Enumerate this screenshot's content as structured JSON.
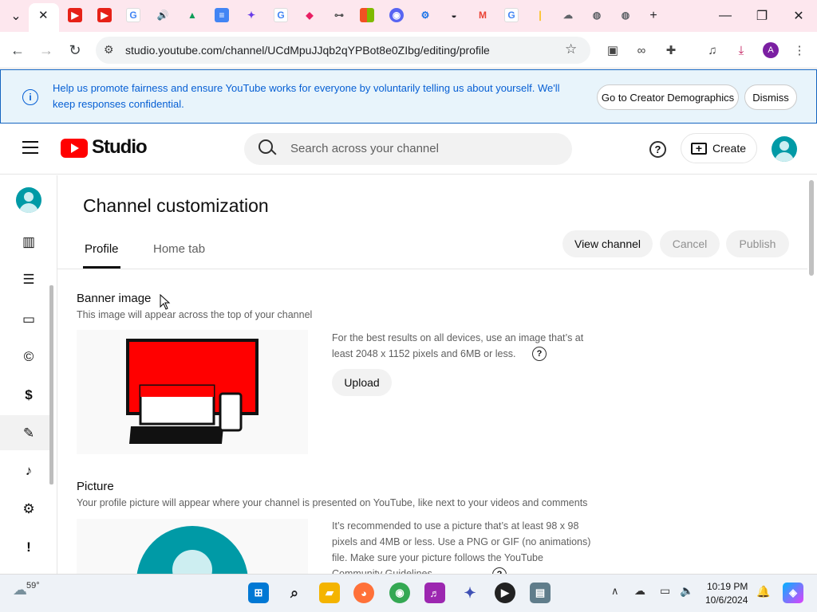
{
  "browser": {
    "url": "studio.youtube.com/channel/UCdMpuJJqb2qYPBot8e0ZIbg/editing/profile",
    "avatar_letter": "A",
    "tab_icons": [
      "tab-search-icon",
      "youtube-icon",
      "youtube-icon",
      "google-icon",
      "audio-icon",
      "drive-icon",
      "docs-icon",
      "extension-icon",
      "google-icon",
      "colorful-icon",
      "key-icon",
      "microsoft-icon",
      "discord-icon",
      "settings-icon",
      "incognito-icon",
      "gmail-icon",
      "google-icon",
      "hashtag-icon",
      "cloud-upload-icon",
      "globe-icon",
      "globe-icon"
    ]
  },
  "notice": {
    "text": "Help us promote fairness and ensure YouTube works for everyone by voluntarily telling us about yourself. We'll keep responses confidential.",
    "primary_label": "Go to Creator Demographics",
    "dismiss_label": "Dismiss"
  },
  "header": {
    "logo_text": "Studio",
    "search_placeholder": "Search across your channel",
    "create_label": "Create"
  },
  "page": {
    "title": "Channel customization",
    "tabs": [
      {
        "label": "Profile",
        "active": true
      },
      {
        "label": "Home tab",
        "active": false
      }
    ],
    "view_channel_label": "View channel",
    "cancel_label": "Cancel",
    "publish_label": "Publish"
  },
  "banner": {
    "title": "Banner image",
    "subtitle": "This image will appear across the top of your channel",
    "description": "For the best results on all devices, use an image that’s at least 2048 x 1152 pixels and 6MB or less.",
    "upload_label": "Upload"
  },
  "picture": {
    "title": "Picture",
    "subtitle": "Your profile picture will appear where your channel is presented on YouTube, like next to your videos and comments",
    "description": "It’s recommended to use a picture that’s at least 98 x 98 pixels and 4MB or less. Use a PNG or GIF (no animations) file. Make sure your picture follows the YouTube Community Guidelines."
  },
  "taskbar": {
    "temperature": "59°",
    "time": "10:19 PM",
    "date": "10/6/2024"
  },
  "colors": {
    "youtube_red": "#ff0000",
    "notice_bg": "#e8f4fb",
    "link_blue": "#065fd4",
    "teal_avatar": "#009aa6"
  }
}
